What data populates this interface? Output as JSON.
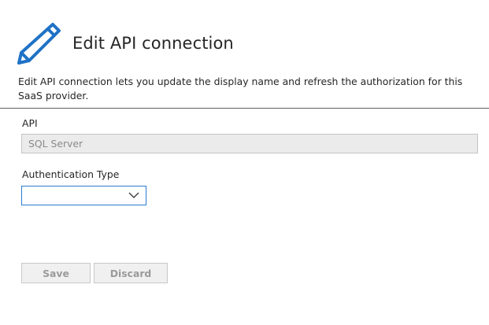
{
  "header": {
    "title": "Edit API connection",
    "description": "Edit API connection lets you update the display name and refresh the authorization for this SaaS provider.",
    "icon": "pencil-icon"
  },
  "form": {
    "api_label": "API",
    "api_value": "SQL Server",
    "auth_label": "Authentication Type",
    "auth_value": ""
  },
  "actions": {
    "save_label": "Save",
    "discard_label": "Discard"
  },
  "colors": {
    "accent": "#2b7cd3",
    "icon": "#1f72c6",
    "disabled_text": "#9a9a9a"
  }
}
